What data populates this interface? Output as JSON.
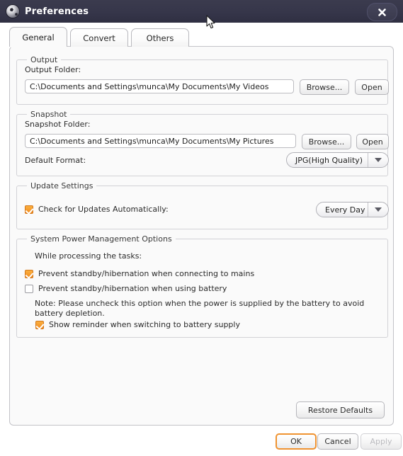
{
  "window": {
    "title": "Preferences",
    "icon": "app-ball-icon",
    "close_label": "close-icon"
  },
  "tabs": [
    {
      "label": "General",
      "active": true
    },
    {
      "label": "Convert",
      "active": false
    },
    {
      "label": "Others",
      "active": false
    }
  ],
  "groups": {
    "output": {
      "title": "Output",
      "folder_label": "Output Folder:",
      "folder_value": "C:\\Documents and Settings\\munca\\My Documents\\My Videos",
      "folder_placeholder": "Output folder path",
      "browse_label": "Browse...",
      "open_label": "Open"
    },
    "snapshot": {
      "title": "Snapshot",
      "folder_label": "Snapshot Folder:",
      "folder_value": "C:\\Documents and Settings\\munca\\My Documents\\My Pictures",
      "folder_placeholder": "Snapshot folder path",
      "browse_label": "Browse...",
      "open_label": "Open",
      "format_label": "Default Format:",
      "format_value": "JPG(High Quality)"
    },
    "update": {
      "title": "Update Settings",
      "check_label": "Check for Updates Automatically:",
      "check_checked": true,
      "frequency_value": "Every Day"
    },
    "power": {
      "title": "System Power Management Options",
      "intro": "While processing the tasks:",
      "option_mains": "Prevent standby/hibernation when connecting to mains",
      "option_mains_checked": true,
      "option_battery": "Prevent standby/hibernation when using battery",
      "option_battery_checked": false,
      "note": "Note: Please uncheck this option when the power is supplied by the battery to avoid battery depletion.",
      "option_reminder": "Show reminder when switching to battery supply",
      "option_reminder_checked": true
    }
  },
  "footer": {
    "restore_label": "Restore Defaults",
    "ok_label": "OK",
    "cancel_label": "Cancel",
    "apply_label": "Apply",
    "apply_enabled": false
  },
  "colors": {
    "titlebar": "#36364a",
    "accent": "#f08a1e",
    "panel": "#fafafa",
    "border": "#c3c3c8"
  }
}
